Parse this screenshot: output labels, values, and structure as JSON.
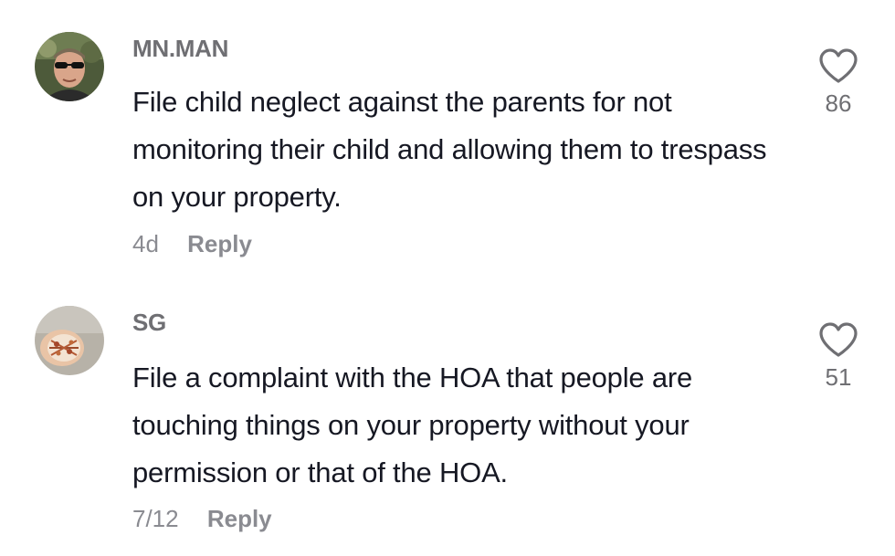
{
  "comments": [
    {
      "username": "MN.MAN",
      "text": "File child neglect against the parents for not monitoring their child and allowing them to trespass on your property.",
      "date": "4d",
      "reply_label": "Reply",
      "likes": "86",
      "avatar_icon": "man-with-sunglasses-avatar"
    },
    {
      "username": "SG",
      "text": "File a complaint with the HOA that people are touching things on your property without your permission or that of the HOA.",
      "date": "7/12",
      "reply_label": "Reply",
      "likes": "51",
      "avatar_icon": "seashell-avatar"
    }
  ],
  "colors": {
    "username": "#6f6f73",
    "body_text": "#161823",
    "meta": "#8a8b91",
    "heart": "#6f6f73"
  }
}
